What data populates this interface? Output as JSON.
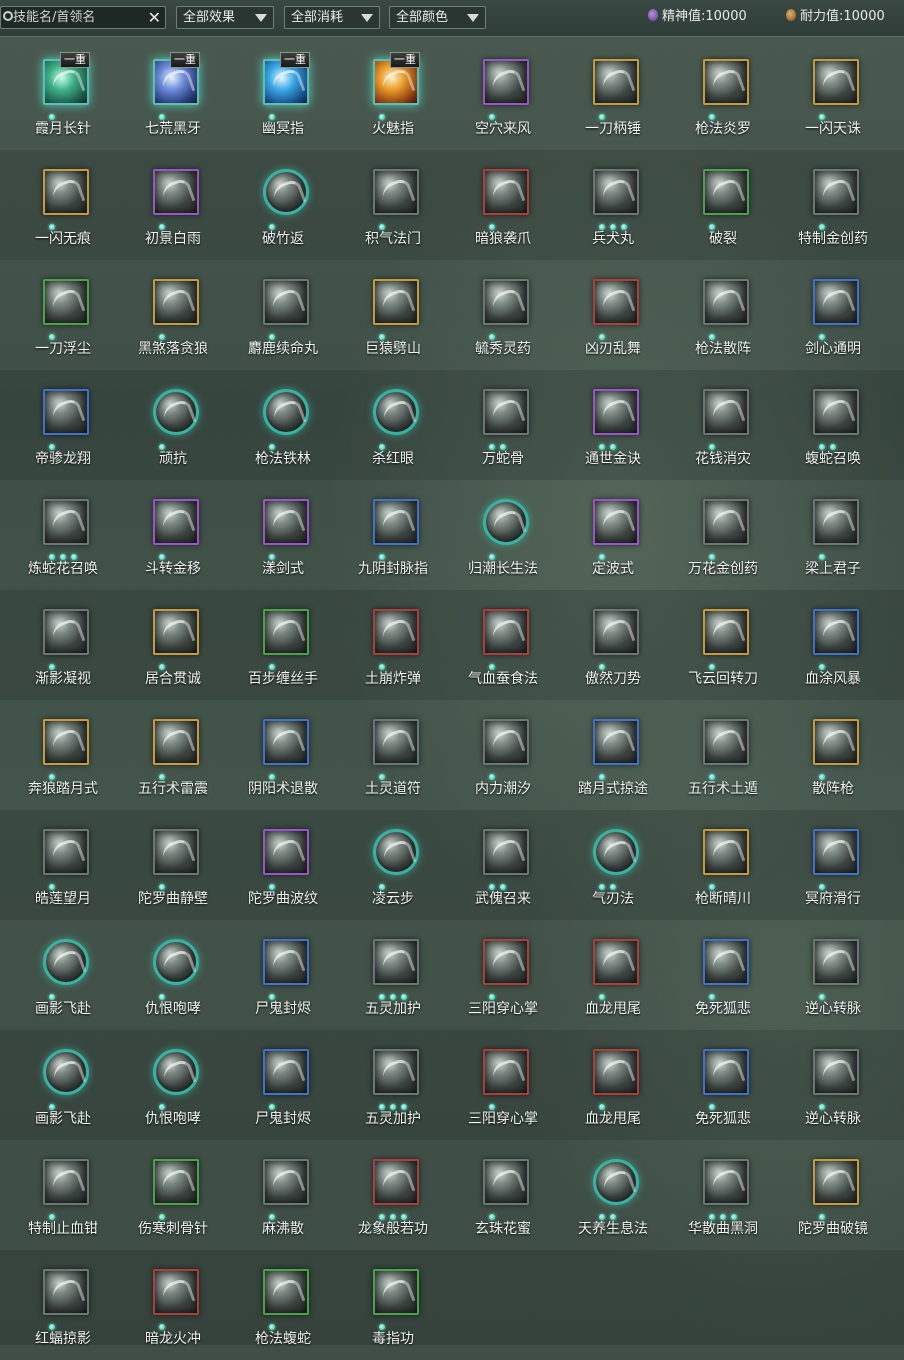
{
  "toolbar": {
    "search_placeholder": "技能名/首领名",
    "clear_glyph": "✕",
    "filter_effect": "全部效果",
    "filter_cost": "全部消耗",
    "filter_color": "全部颜色",
    "spirit_label": "精神值:10000",
    "stamina_label": "耐力值:10000"
  },
  "colors": {
    "dot": "#2fb8a0",
    "frames": {
      "gold": "#c59b3d",
      "purple": "#9a55c8",
      "green": "#4aa24a",
      "blue": "#3f72c8",
      "red": "#a8403c",
      "gray": "#6b7774",
      "teal": "#3ab2a0"
    }
  },
  "skills": [
    {
      "name": "霞月长针",
      "frame": "teal c1",
      "badge": "一重",
      "dots": 1,
      "icon": "needle-skill-icon"
    },
    {
      "name": "七荒黑牙",
      "frame": "teal c2",
      "badge": "一重",
      "dots": 1,
      "icon": "fang-skill-icon"
    },
    {
      "name": "幽冥指",
      "frame": "teal c3",
      "badge": "一重",
      "dots": 1,
      "icon": "finger-skill-icon"
    },
    {
      "name": "火魅指",
      "frame": "teal c4",
      "badge": "一重",
      "dots": 1,
      "icon": "fire-finger-skill-icon"
    },
    {
      "name": "空穴来风",
      "frame": "purple",
      "badge": "",
      "dots": 1,
      "icon": "coin-wind-skill-icon"
    },
    {
      "name": "一刀柄锤",
      "frame": "gold",
      "badge": "",
      "dots": 1,
      "icon": "blade-skill-icon"
    },
    {
      "name": "枪法炎罗",
      "frame": "gold",
      "badge": "",
      "dots": 1,
      "icon": "spear-skill-icon"
    },
    {
      "name": "一闪天诛",
      "frame": "gold",
      "badge": "",
      "dots": 1,
      "icon": "flash-skill-icon"
    },
    {
      "name": "一闪无痕",
      "frame": "gold",
      "badge": "",
      "dots": 1,
      "icon": "slash-skill-icon"
    },
    {
      "name": "初景白雨",
      "frame": "purple",
      "badge": "",
      "dots": 1,
      "icon": "rain-skill-icon"
    },
    {
      "name": "破竹返",
      "frame": "round",
      "badge": "",
      "dots": 1,
      "icon": "bamboo-skill-icon"
    },
    {
      "name": "积气法门",
      "frame": "gray",
      "badge": "",
      "dots": 1,
      "icon": "qi-skill-icon"
    },
    {
      "name": "暗狼袭爪",
      "frame": "red",
      "badge": "",
      "dots": 1,
      "icon": "claw-skill-icon"
    },
    {
      "name": "兵犬丸",
      "frame": "gray",
      "badge": "",
      "dots": 3,
      "icon": "pill-skill-icon"
    },
    {
      "name": "破裂",
      "frame": "green",
      "badge": "",
      "dots": 1,
      "icon": "burst-skill-icon"
    },
    {
      "name": "特制金创药",
      "frame": "gray",
      "badge": "",
      "dots": 1,
      "icon": "medicine-skill-icon"
    },
    {
      "name": "一刀浮尘",
      "frame": "green",
      "badge": "",
      "dots": 1,
      "icon": "dust-blade-skill-icon"
    },
    {
      "name": "黑煞落贪狼",
      "frame": "gold",
      "badge": "",
      "dots": 1,
      "icon": "wolf-skill-icon"
    },
    {
      "name": "麝鹿续命丸",
      "frame": "gray",
      "badge": "",
      "dots": 1,
      "icon": "musk-pill-skill-icon"
    },
    {
      "name": "巨猿劈山",
      "frame": "gold",
      "badge": "",
      "dots": 1,
      "icon": "ape-skill-icon"
    },
    {
      "name": "毓秀灵药",
      "frame": "gray",
      "badge": "",
      "dots": 1,
      "icon": "gourd-skill-icon"
    },
    {
      "name": "凶刃乱舞",
      "frame": "red",
      "badge": "",
      "dots": 1,
      "icon": "blade-dance-skill-icon"
    },
    {
      "name": "枪法散阵",
      "frame": "gray",
      "badge": "",
      "dots": 1,
      "icon": "spear-scatter-skill-icon"
    },
    {
      "name": "剑心通明",
      "frame": "blue",
      "badge": "",
      "dots": 1,
      "icon": "sword-heart-skill-icon"
    },
    {
      "name": "帝骖龙翔",
      "frame": "blue",
      "badge": "",
      "dots": 1,
      "icon": "dragon-skill-icon"
    },
    {
      "name": "顽抗",
      "frame": "round",
      "badge": "",
      "dots": 1,
      "icon": "resist-skill-icon"
    },
    {
      "name": "枪法铁林",
      "frame": "round",
      "badge": "",
      "dots": 1,
      "icon": "iron-forest-skill-icon"
    },
    {
      "name": "杀红眼",
      "frame": "round",
      "badge": "",
      "dots": 1,
      "icon": "rage-skill-icon"
    },
    {
      "name": "万蛇骨",
      "frame": "gray",
      "badge": "",
      "dots": 2,
      "icon": "snake-bone-skill-icon"
    },
    {
      "name": "通世金诀",
      "frame": "purple",
      "badge": "",
      "dots": 2,
      "icon": "dice-skill-icon"
    },
    {
      "name": "花钱消灾",
      "frame": "gray",
      "badge": "",
      "dots": 1,
      "icon": "money-skill-icon"
    },
    {
      "name": "蝮蛇召唤",
      "frame": "gray",
      "badge": "",
      "dots": 2,
      "icon": "viper-skill-icon"
    },
    {
      "name": "炼蛇花召唤",
      "frame": "gray",
      "badge": "",
      "dots": 3,
      "icon": "snake-flower-skill-icon"
    },
    {
      "name": "斗转金移",
      "frame": "purple",
      "badge": "",
      "dots": 1,
      "icon": "gold-shift-skill-icon"
    },
    {
      "name": "漾剑式",
      "frame": "purple",
      "badge": "",
      "dots": 1,
      "icon": "ripple-sword-skill-icon"
    },
    {
      "name": "九阴封脉指",
      "frame": "blue",
      "badge": "",
      "dots": 1,
      "icon": "seal-finger-skill-icon"
    },
    {
      "name": "归潮长生法",
      "frame": "round",
      "badge": "",
      "dots": 1,
      "icon": "tide-skill-icon"
    },
    {
      "name": "定波式",
      "frame": "purple",
      "badge": "",
      "dots": 1,
      "icon": "wave-skill-icon"
    },
    {
      "name": "万花金创药",
      "frame": "gray",
      "badge": "",
      "dots": 1,
      "icon": "flower-medicine-skill-icon"
    },
    {
      "name": "梁上君子",
      "frame": "gray",
      "badge": "",
      "dots": 1,
      "icon": "thief-skill-icon"
    },
    {
      "name": "渐影凝视",
      "frame": "gray",
      "badge": "",
      "dots": 1,
      "icon": "gaze-skill-icon"
    },
    {
      "name": "居合贯诚",
      "frame": "gold",
      "badge": "",
      "dots": 1,
      "icon": "iai-skill-icon"
    },
    {
      "name": "百步缠丝手",
      "frame": "green",
      "badge": "",
      "dots": 1,
      "icon": "silk-hand-skill-icon"
    },
    {
      "name": "土崩炸弹",
      "frame": "red",
      "badge": "",
      "dots": 1,
      "icon": "bomb-skill-icon"
    },
    {
      "name": "气血蚕食法",
      "frame": "red",
      "badge": "",
      "dots": 1,
      "icon": "devour-skill-icon"
    },
    {
      "name": "傲然刀势",
      "frame": "gray",
      "badge": "",
      "dots": 1,
      "icon": "pride-blade-skill-icon"
    },
    {
      "name": "飞云回转刀",
      "frame": "gold",
      "badge": "",
      "dots": 1,
      "icon": "cloud-blade-skill-icon"
    },
    {
      "name": "血涂风暴",
      "frame": "blue",
      "badge": "",
      "dots": 1,
      "icon": "storm-skill-icon"
    },
    {
      "name": "奔狼踏月式",
      "frame": "gold",
      "badge": "",
      "dots": 1,
      "icon": "running-wolf-skill-icon"
    },
    {
      "name": "五行术雷震",
      "frame": "gold",
      "badge": "",
      "dots": 1,
      "icon": "thunder-skill-icon"
    },
    {
      "name": "阴阳术退散",
      "frame": "blue",
      "badge": "",
      "dots": 1,
      "icon": "yinyang-skill-icon"
    },
    {
      "name": "土灵道符",
      "frame": "gray",
      "badge": "",
      "dots": 1,
      "icon": "talisman-skill-icon"
    },
    {
      "name": "内力潮汐",
      "frame": "gray",
      "badge": "",
      "dots": 1,
      "icon": "inner-tide-skill-icon"
    },
    {
      "name": "踏月式掠途",
      "frame": "blue",
      "badge": "",
      "dots": 1,
      "icon": "moon-step-skill-icon"
    },
    {
      "name": "五行术土遁",
      "frame": "gray",
      "badge": "",
      "dots": 1,
      "icon": "earth-escape-skill-icon"
    },
    {
      "name": "散阵枪",
      "frame": "gold",
      "badge": "",
      "dots": 1,
      "icon": "scatter-spear-skill-icon"
    },
    {
      "name": "皓莲望月",
      "frame": "gray",
      "badge": "",
      "dots": 1,
      "icon": "lotus-moon-skill-icon"
    },
    {
      "name": "陀罗曲静壁",
      "frame": "gray",
      "badge": "",
      "dots": 1,
      "icon": "still-wall-skill-icon"
    },
    {
      "name": "陀罗曲波纹",
      "frame": "purple",
      "badge": "",
      "dots": 1,
      "icon": "ripple-skill-icon"
    },
    {
      "name": "凌云步",
      "frame": "round",
      "badge": "",
      "dots": 1,
      "icon": "cloud-step-skill-icon"
    },
    {
      "name": "武傀召来",
      "frame": "gray",
      "badge": "",
      "dots": 2,
      "icon": "puppet-skill-icon"
    },
    {
      "name": "气刃法",
      "frame": "round",
      "badge": "",
      "dots": 2,
      "icon": "qi-blade-skill-icon"
    },
    {
      "name": "枪断晴川",
      "frame": "gold",
      "badge": "",
      "dots": 1,
      "icon": "spear-river-skill-icon"
    },
    {
      "name": "冥府滑行",
      "frame": "blue",
      "badge": "",
      "dots": 1,
      "icon": "underworld-glide-skill-icon"
    },
    {
      "name": "画影飞赴",
      "frame": "round",
      "badge": "",
      "dots": 1,
      "icon": "shadow-dash-skill-icon"
    },
    {
      "name": "仇恨咆哮",
      "frame": "round",
      "badge": "",
      "dots": 1,
      "icon": "roar-skill-icon"
    },
    {
      "name": "尸鬼封烬",
      "frame": "blue",
      "badge": "",
      "dots": 1,
      "icon": "ghost-seal-skill-icon"
    },
    {
      "name": "五灵加护",
      "frame": "gray",
      "badge": "",
      "dots": 3,
      "icon": "five-spirit-skill-icon"
    },
    {
      "name": "三阳穿心掌",
      "frame": "red",
      "badge": "",
      "dots": 1,
      "icon": "palm-skill-icon"
    },
    {
      "name": "血龙甩尾",
      "frame": "red",
      "badge": "",
      "dots": 1,
      "icon": "blood-dragon-skill-icon"
    },
    {
      "name": "免死狐悲",
      "frame": "blue",
      "badge": "",
      "dots": 1,
      "icon": "fox-skill-icon"
    },
    {
      "name": "逆心转脉",
      "frame": "gray",
      "badge": "",
      "dots": 1,
      "icon": "reverse-heart-skill-icon"
    },
    {
      "name": "画影飞赴",
      "frame": "round",
      "badge": "",
      "dots": 1,
      "icon": "shadow-dash-skill-icon"
    },
    {
      "name": "仇恨咆哮",
      "frame": "round",
      "badge": "",
      "dots": 1,
      "icon": "roar-skill-icon"
    },
    {
      "name": "尸鬼封烬",
      "frame": "blue",
      "badge": "",
      "dots": 1,
      "icon": "ghost-seal-skill-icon"
    },
    {
      "name": "五灵加护",
      "frame": "gray",
      "badge": "",
      "dots": 3,
      "icon": "five-spirit-skill-icon"
    },
    {
      "name": "三阳穿心掌",
      "frame": "red",
      "badge": "",
      "dots": 1,
      "icon": "palm-skill-icon"
    },
    {
      "name": "血龙甩尾",
      "frame": "red",
      "badge": "",
      "dots": 1,
      "icon": "blood-dragon-skill-icon"
    },
    {
      "name": "免死狐悲",
      "frame": "blue",
      "badge": "",
      "dots": 1,
      "icon": "fox-skill-icon"
    },
    {
      "name": "逆心转脉",
      "frame": "gray",
      "badge": "",
      "dots": 1,
      "icon": "reverse-heart-skill-icon"
    },
    {
      "name": "特制止血钳",
      "frame": "gray",
      "badge": "",
      "dots": 1,
      "icon": "clamp-skill-icon"
    },
    {
      "name": "伤寒刺骨针",
      "frame": "green",
      "badge": "",
      "dots": 1,
      "icon": "cold-needle-skill-icon"
    },
    {
      "name": "麻沸散",
      "frame": "gray",
      "badge": "",
      "dots": 1,
      "icon": "anesthetic-skill-icon"
    },
    {
      "name": "龙象般若功",
      "frame": "red",
      "badge": "",
      "dots": 3,
      "icon": "dragon-elephant-skill-icon"
    },
    {
      "name": "玄珠花蜜",
      "frame": "gray",
      "badge": "",
      "dots": 1,
      "icon": "nectar-skill-icon"
    },
    {
      "name": "天养生息法",
      "frame": "round",
      "badge": "",
      "dots": 2,
      "icon": "nurture-skill-icon"
    },
    {
      "name": "华散曲黑洞",
      "frame": "gray",
      "badge": "",
      "dots": 3,
      "icon": "black-hole-skill-icon"
    },
    {
      "name": "陀罗曲破镜",
      "frame": "gold",
      "badge": "",
      "dots": 1,
      "icon": "broken-mirror-skill-icon"
    },
    {
      "name": "红蝠掠影",
      "frame": "gray",
      "badge": "",
      "dots": 1,
      "icon": "bat-skill-icon"
    },
    {
      "name": "暗龙火冲",
      "frame": "red",
      "badge": "",
      "dots": 1,
      "icon": "fire-dragon-skill-icon"
    },
    {
      "name": "枪法蝮蛇",
      "frame": "green",
      "badge": "",
      "dots": 1,
      "icon": "viper-spear-skill-icon"
    },
    {
      "name": "毒指功",
      "frame": "green",
      "badge": "",
      "dots": 1,
      "icon": "poison-finger-skill-icon"
    }
  ]
}
